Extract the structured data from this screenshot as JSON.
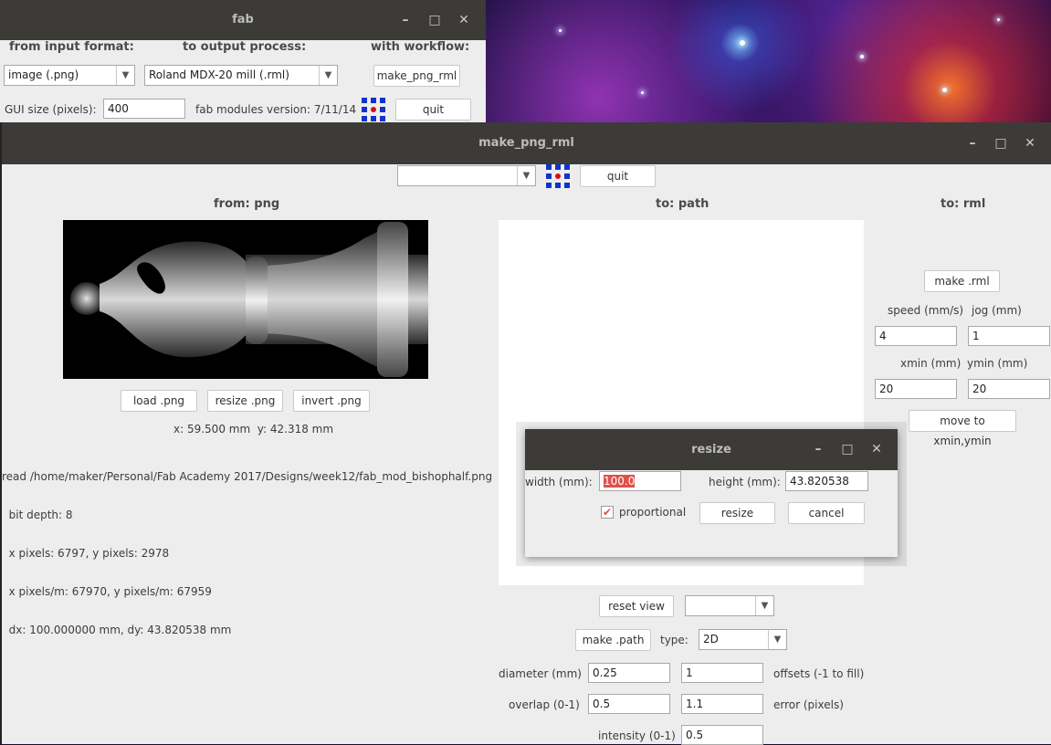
{
  "fab_window": {
    "title": "fab",
    "from_input_label": "from input format:",
    "to_output_label": "to output process:",
    "workflow_label": "with workflow:",
    "input_format": "image (.png)",
    "output_process": "Roland MDX-20 mill (.rml)",
    "workflow_button": "make_png_rml",
    "gui_size_label": "GUI size (pixels):",
    "gui_size_value": "400",
    "version_text": "fab modules version: 7/11/14",
    "quit_label": "quit"
  },
  "main_window": {
    "title": "make_png_rml",
    "top_select_value": "",
    "quit_label": "quit",
    "from_header": "from: png",
    "path_header": "to: path",
    "rml_header": "to: rml",
    "load_png": "load .png",
    "resize_png": "resize .png",
    "invert_png": "invert .png",
    "coords": "x: 59.500 mm  y: 42.318 mm",
    "info_lines": [
      "read /home/maker/Personal/Fab Academy 2017/Designs/week12/fab_mod_bishophalf.png",
      "  bit depth: 8",
      "  x pixels: 6797, y pixels: 2978",
      "  x pixels/m: 67970, y pixels/m: 67959",
      "  dx: 100.000000 mm, dy: 43.820538 mm"
    ],
    "reset_view": "reset view",
    "view_select": "",
    "make_path": "make .path",
    "type_label": "type:",
    "type_value": "2D",
    "diameter_label": "diameter (mm)",
    "diameter_value": "0.25",
    "offsets_value": "1",
    "offsets_label": "offsets (-1 to fill)",
    "overlap_label": "overlap (0-1)",
    "overlap_value": "0.5",
    "error_value": "1.1",
    "error_label": "error (pixels)",
    "intensity_label": "intensity (0-1)",
    "intensity_value": "0.5",
    "make_rml": "make .rml",
    "speed_label": "speed (mm/s)",
    "jog_label": "jog (mm)",
    "speed_value": "4",
    "jog_value": "1",
    "xmin_label": "xmin (mm)",
    "ymin_label": "ymin (mm)",
    "xmin_value": "20",
    "ymin_value": "20",
    "move_button": "move to xmin,ymin"
  },
  "resize_dialog": {
    "title": "resize",
    "width_label": "width (mm):",
    "width_value": "100.0",
    "height_label": "height (mm):",
    "height_value": "43.820538",
    "proportional_label": "proportional",
    "proportional_checked": true,
    "resize_button": "resize",
    "cancel_button": "cancel"
  },
  "window_controls": {
    "minimize": "–",
    "maximize": "□",
    "close": "✕"
  },
  "colors": {
    "titlebar": "#3c3b37",
    "window_bg": "#ededed",
    "selection": "#e0504a",
    "checkbox": "#d9534f"
  }
}
